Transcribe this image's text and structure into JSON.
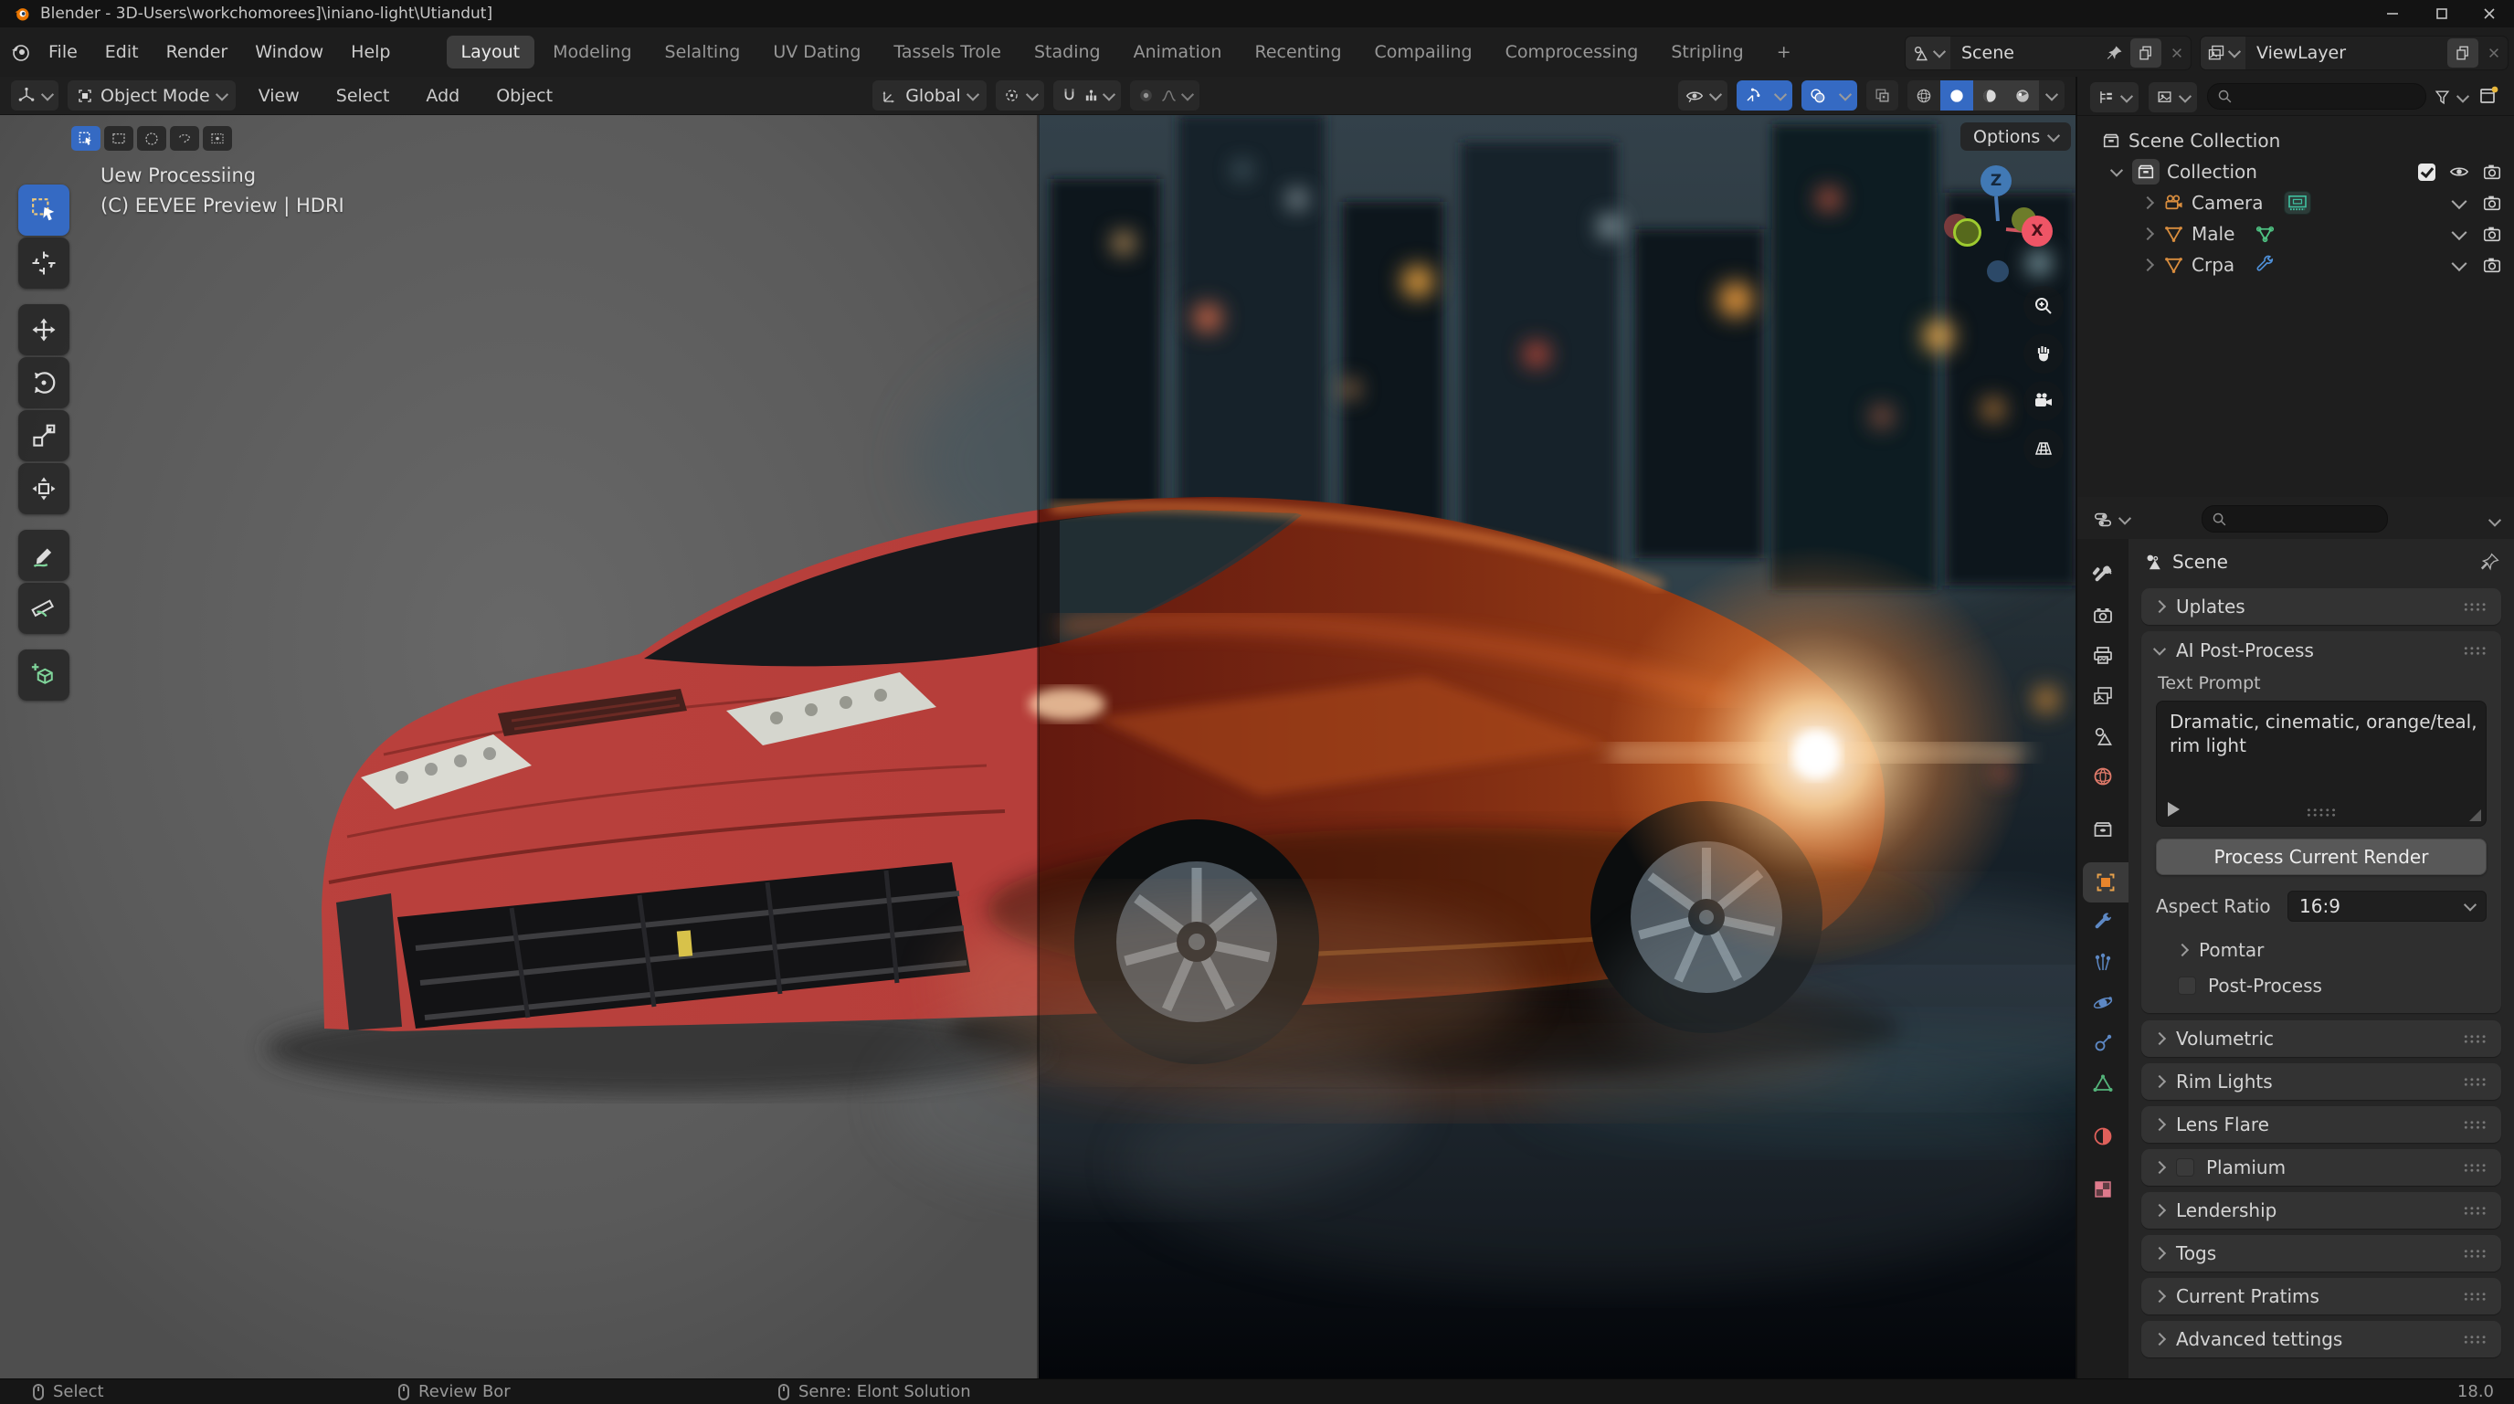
{
  "window": {
    "title": "Blender - 3D-Users\\workchomorees]\\iniano-light\\Utiandut]"
  },
  "menubar": {
    "menus": [
      "File",
      "Edit",
      "Render",
      "Window",
      "Help"
    ],
    "workspaces": [
      "Layout",
      "Modeling",
      "Selalting",
      "UV Dating",
      "Tassels Trole",
      "Stading",
      "Animation",
      "Recenting",
      "Compailing",
      "Comprocessing",
      "Stripling"
    ],
    "active_workspace": "Layout",
    "add_tab": "+",
    "scene_selector": {
      "value": "Scene"
    },
    "viewlayer_selector": {
      "value": "ViewLayer"
    }
  },
  "viewport_header": {
    "mode_selector": "Object Mode",
    "menus": [
      "View",
      "Select",
      "Add",
      "Object"
    ],
    "orientation_selector": "Global"
  },
  "viewport": {
    "options_button": "Options",
    "overlay": {
      "line1": "Uew Processiing",
      "line2": "(C) EEVEE Preview | HDRI"
    },
    "gizmo": {
      "z_label": "Z",
      "x_label": "X"
    }
  },
  "outliner": {
    "root_label": "Scene Collection",
    "collection": {
      "label": "Collection"
    },
    "objects": [
      {
        "label": "Camera"
      },
      {
        "label": "Male"
      },
      {
        "label": "Crpa"
      }
    ]
  },
  "properties": {
    "breadcrumb": "Scene",
    "panel_uplates": "Uplates",
    "ai_panel": {
      "title": "AI Post-Process",
      "prompt_label": "Text Prompt",
      "prompt_value": "Dramatic, cinematic, orange/teal, rim light",
      "process_button": "Process Current Render",
      "aspect_label": "Aspect Ratio",
      "aspect_value": "16:9",
      "subpanel_pomtar": "Pomtar",
      "checkbox_post_process": "Post-Process"
    },
    "panels": [
      "Volumetric",
      "Rim Lights",
      "Lens Flare",
      "Plamium",
      "Lendership",
      "Togs",
      "Current Pratims",
      "Advanced tettings"
    ]
  },
  "statusbar": {
    "select": "Select",
    "review": "Review Bor",
    "scene_stats": "Senre: Elont Solution",
    "version": "18.0"
  },
  "colors": {
    "accent_blue": "#356ac3",
    "blender_orange": "#e8852c",
    "active_tab": "#3d3d3d"
  }
}
